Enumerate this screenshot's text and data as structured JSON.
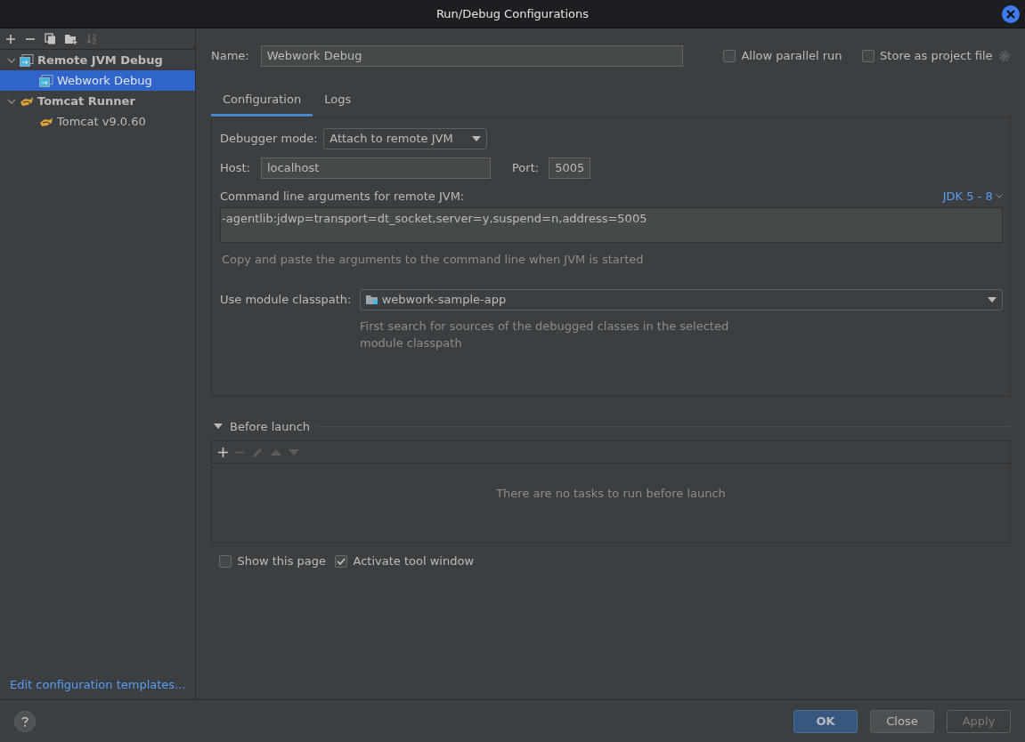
{
  "window": {
    "title": "Run/Debug Configurations"
  },
  "tree": [
    {
      "label": "Remote JVM Debug",
      "kind": "remote",
      "expanded": true,
      "selected": false,
      "children": [
        {
          "label": "Webwork Debug",
          "kind": "remote",
          "selected": true
        }
      ]
    },
    {
      "label": "Tomcat Runner",
      "kind": "tomcat",
      "expanded": true,
      "selected": false,
      "children": [
        {
          "label": "Tomcat v9.0.60",
          "kind": "tomcat",
          "selected": false
        }
      ]
    }
  ],
  "templates_link": "Edit configuration templates...",
  "name_field": {
    "label": "Name:",
    "value": "Webwork Debug"
  },
  "options": [
    {
      "label": "Allow parallel run",
      "checked": false
    },
    {
      "label": "Store as project file",
      "checked": false
    }
  ],
  "tabs": [
    {
      "label": "Configuration",
      "selected": true
    },
    {
      "label": "Logs",
      "selected": false
    }
  ],
  "debugger_mode": {
    "label": "Debugger mode:",
    "value": "Attach to remote JVM"
  },
  "host": {
    "label": "Host:",
    "value": "localhost"
  },
  "port": {
    "label": "Port:",
    "value": "5005"
  },
  "command_line": {
    "label": "Command line arguments for remote JVM:",
    "jdk": "JDK 5 - 8",
    "value": "-agentlib:jdwp=transport=dt_socket,server=y,suspend=n,address=5005",
    "hint": "Copy and paste the arguments to the command line when JVM is started"
  },
  "module_classpath": {
    "label": "Use module classpath:",
    "value": "webwork-sample-app",
    "hint": "First search for sources of the debugged classes in the selected module classpath"
  },
  "before_launch": {
    "title": "Before launch",
    "expanded": true,
    "empty_text": "There are no tasks to run before launch"
  },
  "launch_options": [
    {
      "label": "Show this page",
      "checked": false
    },
    {
      "label": "Activate tool window",
      "checked": true
    }
  ],
  "buttons": [
    {
      "label": "OK",
      "kind": "primary",
      "disabled": false
    },
    {
      "label": "Close",
      "kind": "default",
      "disabled": false
    },
    {
      "label": "Apply",
      "kind": "default",
      "disabled": true
    }
  ]
}
